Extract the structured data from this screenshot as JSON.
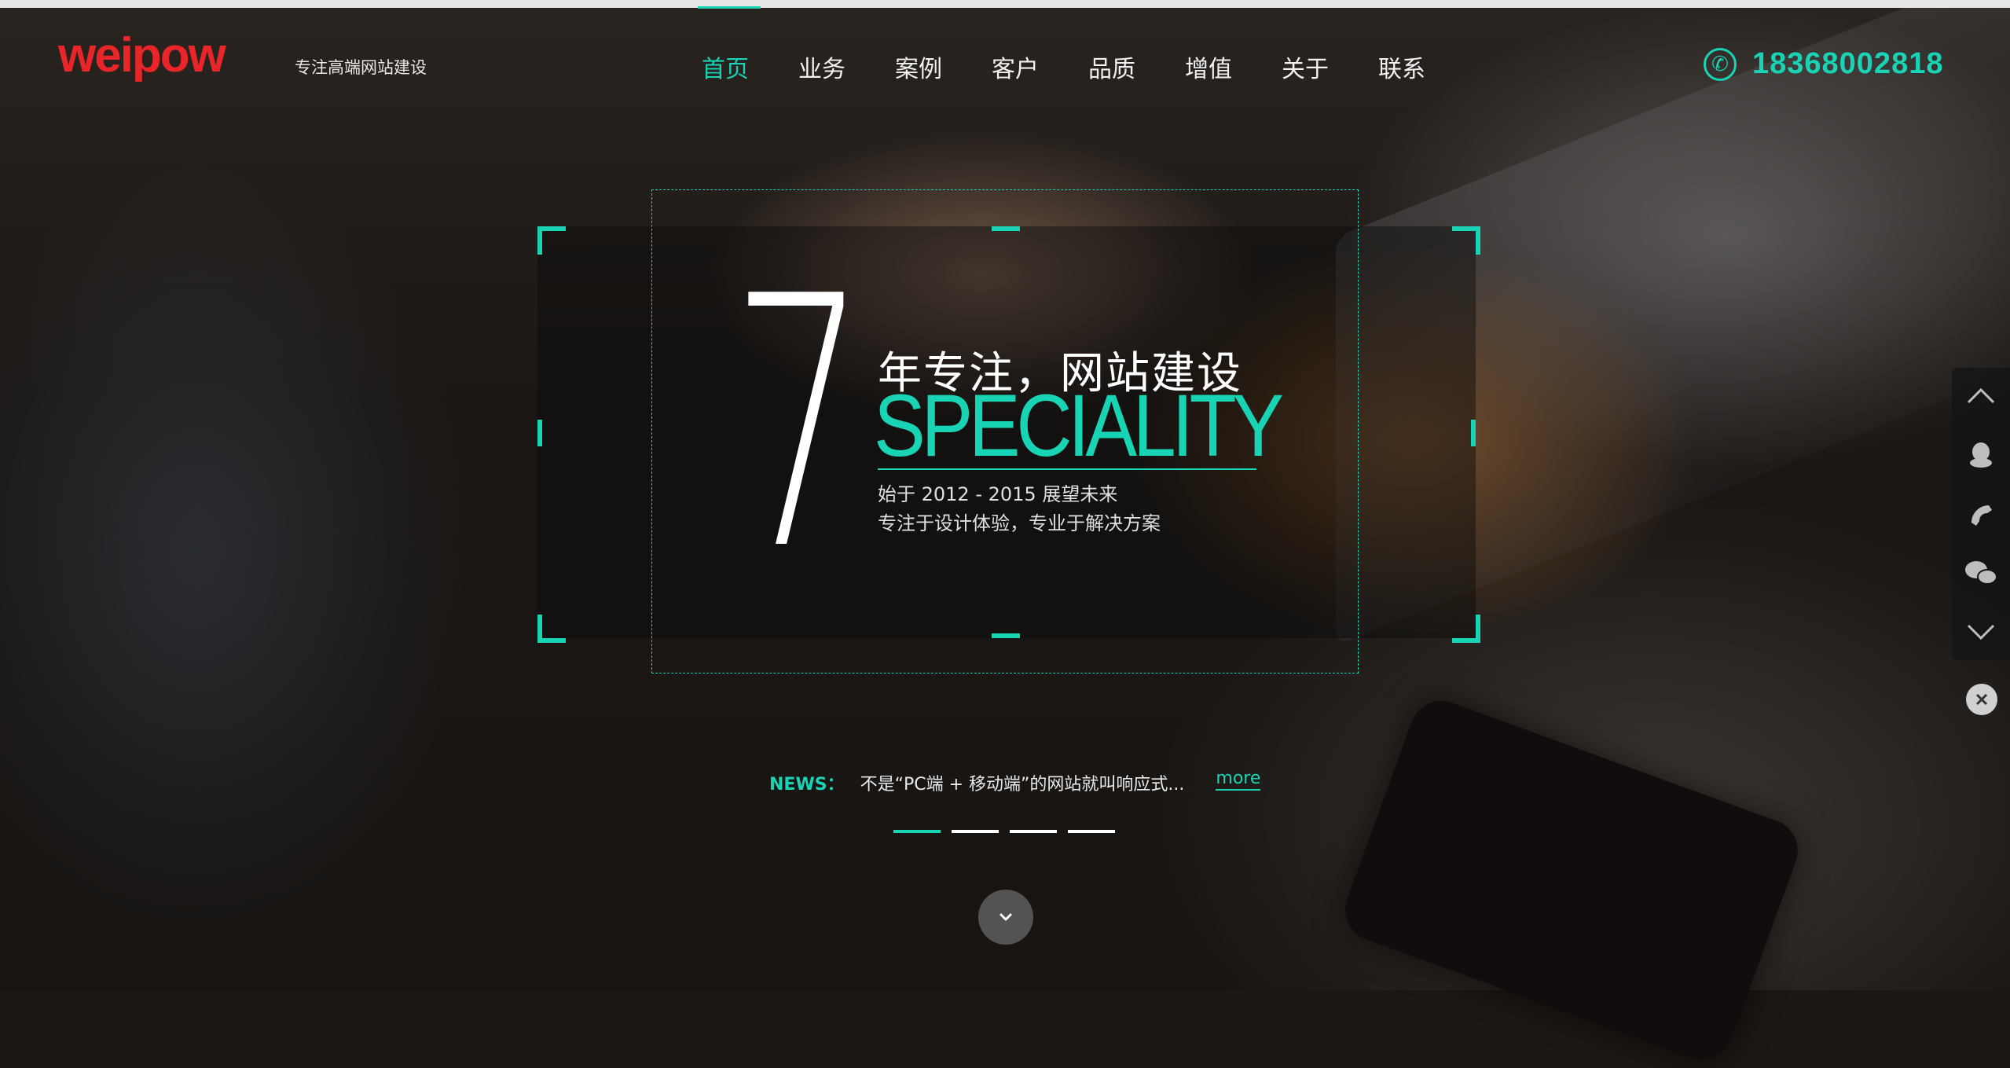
{
  "brand": {
    "logo_text": "weipow",
    "tagline": "专注高端网站建设",
    "accent_color": "#19d3b5",
    "logo_color": "#e8262a"
  },
  "nav": {
    "items": [
      {
        "label": "首页",
        "active": true
      },
      {
        "label": "业务",
        "active": false
      },
      {
        "label": "案例",
        "active": false
      },
      {
        "label": "客户",
        "active": false
      },
      {
        "label": "品质",
        "active": false
      },
      {
        "label": "增值",
        "active": false
      },
      {
        "label": "关于",
        "active": false
      },
      {
        "label": "联系",
        "active": false
      }
    ]
  },
  "contact": {
    "phone_icon": "phone-icon",
    "phone_number": "18368002818"
  },
  "hero": {
    "big_number": "7",
    "heading": "年专注，网站建设",
    "speciality": "SPECIALITY",
    "line1": "始于 2012 - 2015 展望未来",
    "line2": "专注于设计体验，专业于解决方案"
  },
  "news": {
    "label": "NEWS：",
    "text": "不是“PC端 + 移动端”的网站就叫响应式...",
    "more": "more"
  },
  "slider": {
    "count": 4,
    "active_index": 0
  },
  "sidebar": {
    "icons": [
      "chevron-up-icon",
      "qq-icon",
      "phone-icon",
      "wechat-icon",
      "chevron-down-icon"
    ],
    "close_icon": "close-icon"
  }
}
